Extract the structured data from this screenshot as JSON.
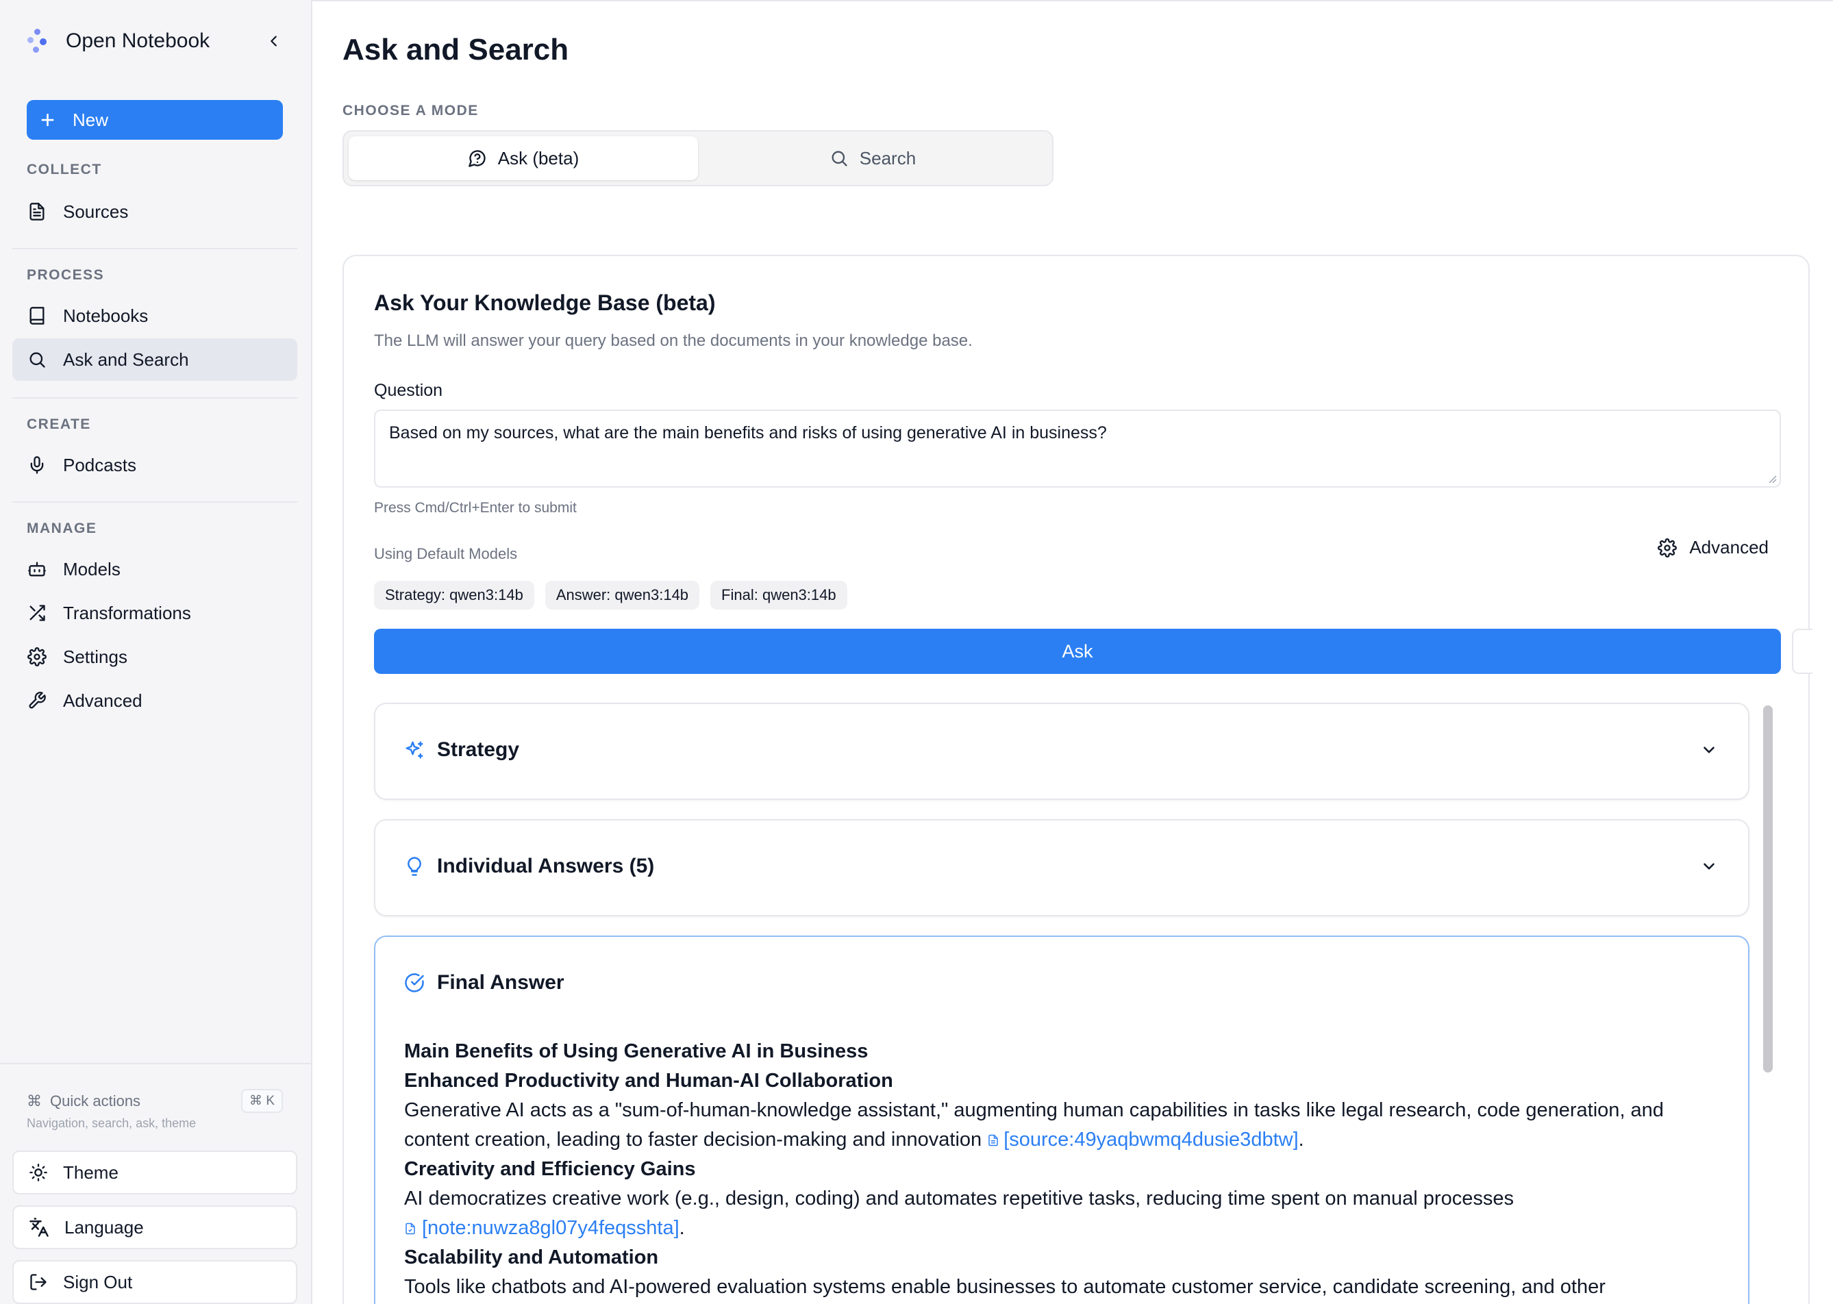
{
  "app": {
    "name": "Open Notebook",
    "accent": "#2b7ff3"
  },
  "sidebar": {
    "new_label": "New",
    "sections": {
      "collect": "COLLECT",
      "process": "PROCESS",
      "create": "CREATE",
      "manage": "MANAGE"
    },
    "items": {
      "sources": "Sources",
      "notebooks": "Notebooks",
      "ask_search": "Ask and Search",
      "podcasts": "Podcasts",
      "models": "Models",
      "transformations": "Transformations",
      "settings": "Settings",
      "advanced": "Advanced"
    },
    "quick_actions": {
      "label": "Quick actions",
      "shortcut": "⌘ K",
      "hint": "Navigation, search, ask, theme"
    },
    "bottom": {
      "theme": "Theme",
      "language": "Language",
      "sign_out": "Sign Out"
    }
  },
  "main": {
    "title": "Ask and Search",
    "mode_label": "CHOOSE A MODE",
    "modes": {
      "ask": "Ask (beta)",
      "search": "Search"
    },
    "card": {
      "title": "Ask Your Knowledge Base (beta)",
      "description": "The LLM will answer your query based on the documents in your knowledge base.",
      "question_label": "Question",
      "question_value": "Based on my sources, what are the main benefits and risks of using generative AI in business?",
      "hint": "Press Cmd/Ctrl+Enter to submit",
      "models_label": "Using Default Models",
      "advanced_label": "Advanced",
      "chips": {
        "strategy": "Strategy: qwen3:14b",
        "answer": "Answer: qwen3:14b",
        "final": "Final: qwen3:14b"
      },
      "ask_label": "Ask"
    },
    "panels": {
      "strategy": "Strategy",
      "individual": "Individual Answers (5)",
      "final": "Final Answer"
    },
    "answer": {
      "h1": "Main Benefits of Using Generative AI in Business",
      "h2": "Enhanced Productivity and Human-AI Collaboration",
      "p2": "Generative AI acts as a \"sum-of-human-knowledge assistant,\" augmenting human capabilities in tasks like legal research, code generation, and content creation, leading to faster decision-making and innovation ",
      "c2": "[source:49yaqbwmq4dusie3dbtw]",
      "h3": "Creativity and Efficiency Gains",
      "p3": "AI democratizes creative work (e.g., design, coding) and automates repetitive tasks, reducing time spent on manual processes ",
      "c3": "[note:nuwza8gl07y4feqsshta]",
      "h4": "Scalability and Automation",
      "p4": "Tools like chatbots and AI-powered evaluation systems enable businesses to automate customer service, candidate screening, and other"
    }
  }
}
